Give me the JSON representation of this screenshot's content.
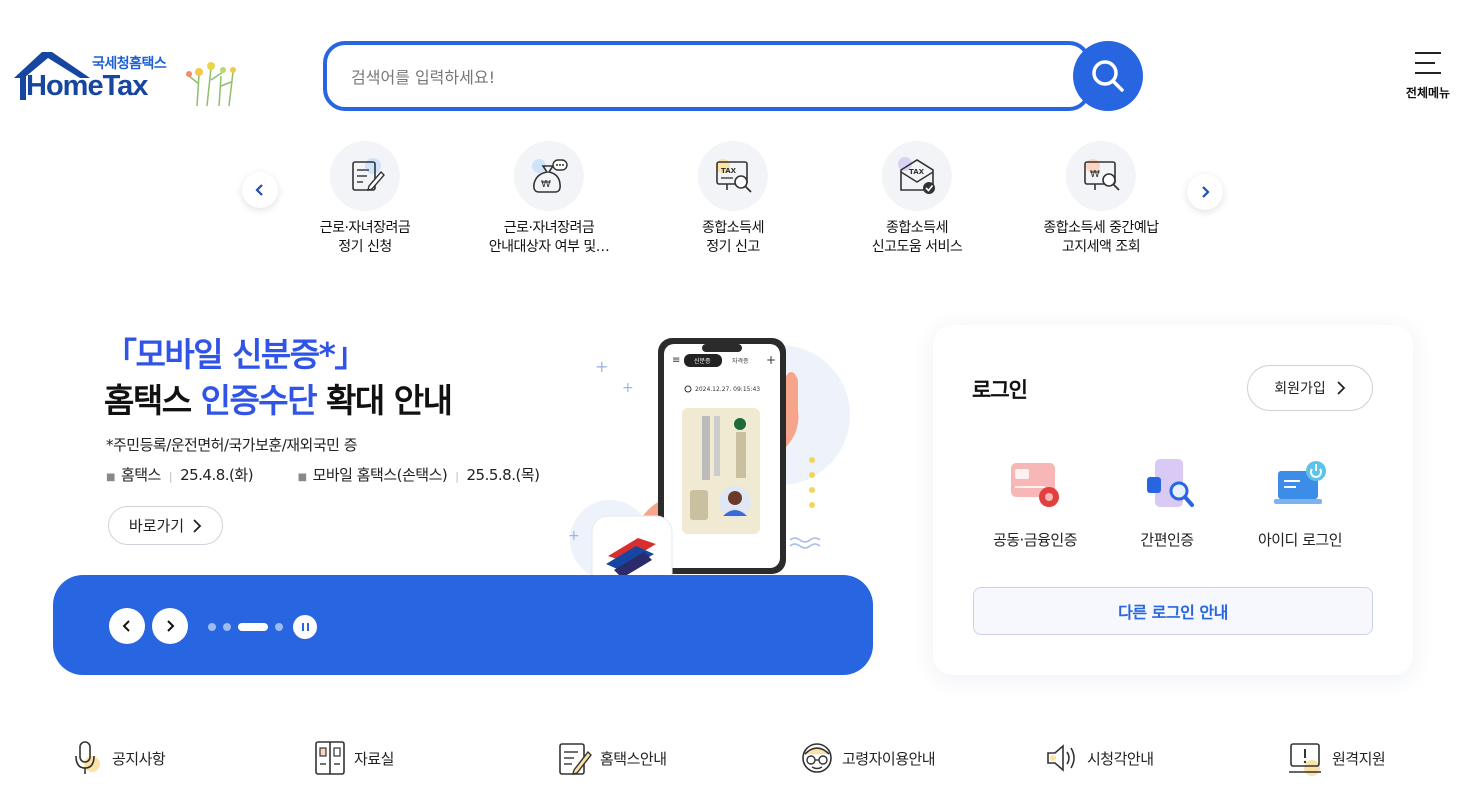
{
  "header": {
    "logo_small": "국세청홈택스",
    "logo_big": "HomeTax",
    "search_placeholder": "검색어를 입력하세요!",
    "all_menu_label": "전체메뉴"
  },
  "quick_menu": {
    "items": [
      {
        "line1": "근로·자녀장려금",
        "line2": "정기 신청",
        "icon": "document-pen-icon"
      },
      {
        "line1": "근로·자녀장려금",
        "line2": "안내대상자 여부 및…",
        "icon": "money-bag-chat-icon"
      },
      {
        "line1": "종합소득세",
        "line2": "정기 신고",
        "icon": "tax-monitor-search-icon"
      },
      {
        "line1": "종합소득세",
        "line2": "신고도움 서비스",
        "icon": "tax-envelope-check-icon"
      },
      {
        "line1": "종합소득세 중간예납",
        "line2": "고지세액 조회",
        "icon": "won-monitor-search-icon"
      }
    ]
  },
  "banner": {
    "title_line1": "「모바일 신분증*」",
    "title_line2_a": "홈택스 ",
    "title_line2_b": "인증수단",
    "title_line2_c": " 확대 안내",
    "note": "*주민등록/운전면허/국가보훈/재외국민 증",
    "date1_label": "홈택스",
    "date1_value": "25.4.8.(화)",
    "date2_label": "모바일 홈택스(손택스)",
    "date2_value": "25.5.8.(목)",
    "go_label": "바로가기",
    "phone_tab1": "신분증",
    "phone_tab2": "자격증",
    "phone_time": "2024.12.27. 09:15:43",
    "accent": "#2766e0"
  },
  "login": {
    "title": "로그인",
    "join_label": "회원가입",
    "options": [
      {
        "label": "공동·금융인증",
        "icon": "certificate-card-icon"
      },
      {
        "label": "간편인증",
        "icon": "phone-search-icon"
      },
      {
        "label": "아이디 로그인",
        "icon": "laptop-power-icon"
      }
    ],
    "other_login": "다른 로그인 안내"
  },
  "bottom_nav": {
    "items": [
      {
        "label": "공지사항",
        "icon": "microphone-icon"
      },
      {
        "label": "자료실",
        "icon": "cabinet-icon"
      },
      {
        "label": "홈택스안내",
        "icon": "guide-document-icon"
      },
      {
        "label": "고령자이용안내",
        "icon": "senior-face-icon"
      },
      {
        "label": "시청각안내",
        "icon": "speaker-icon"
      },
      {
        "label": "원격지원",
        "icon": "remote-support-icon"
      }
    ]
  }
}
